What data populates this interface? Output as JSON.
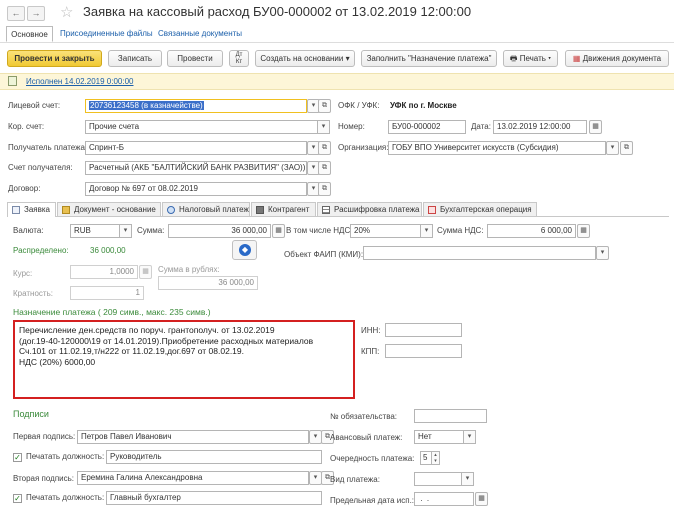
{
  "window": {
    "title": "Заявка на кассовый расход БУ00-000002 от 13.02.2019 12:00:00"
  },
  "nav_tabs": {
    "main": "Основное",
    "attached": "Присоединенные файлы",
    "related": "Связанные документы"
  },
  "toolbar": {
    "post_close": "Провести и закрыть",
    "save": "Записать",
    "post": "Провести",
    "create_based": "Создать на основании",
    "fill_purpose": "Заполнить \"Назначение платежа\"",
    "print": "Печать",
    "movements": "Движения документа"
  },
  "status": {
    "text": "Исполнен 14.02.2019 0:00:00"
  },
  "header_left": {
    "account_label": "Лицевой счет:",
    "account_value": "20736123458 (в казначействе)",
    "corr_label": "Кор. счет:",
    "corr_value": "Прочие счета",
    "recipient_label": "Получатель платежа:",
    "recipient_value": "Спринт-Б",
    "recipient_acc_label": "Счет получателя:",
    "recipient_acc_value": "Расчетный (АКБ \"БАЛТИЙСКИЙ БАНК РАЗВИТИЯ\" (ЗАО))",
    "contract_label": "Договор:",
    "contract_value": "Договор № 697 от 08.02.2019"
  },
  "header_right": {
    "ofk_label": "ОФК / УФК:",
    "ofk_value": "УФК по г. Москве",
    "number_label": "Номер:",
    "number_value": "БУ00-000002",
    "date_label": "Дата:",
    "date_value": "13.02.2019 12:00:00",
    "org_label": "Организация:",
    "org_value": "ГОБУ ВПО Университет искусств (Субсидия)"
  },
  "tabs": [
    {
      "label": "Заявка",
      "icon": "document-icon",
      "active": true
    },
    {
      "label": "Документ - основание",
      "icon": "folder-icon",
      "active": false
    },
    {
      "label": "Налоговый платеж",
      "icon": "tax-icon",
      "active": false
    },
    {
      "label": "Контрагент",
      "icon": "building-icon",
      "active": false
    },
    {
      "label": "Расшифровка платежа",
      "icon": "table-icon",
      "active": false
    },
    {
      "label": "Бухгалтерская операция",
      "icon": "ledger-icon",
      "active": false
    }
  ],
  "request": {
    "currency_label": "Валюта:",
    "currency_value": "RUB",
    "sum_label": "Сумма:",
    "sum_value": "36 000,00",
    "vat_incl_label": "В том числе НДС:",
    "vat_incl_value": "20%",
    "vat_sum_label": "Сумма НДС:",
    "vat_sum_value": "6 000,00",
    "distributed_label": "Распределено:",
    "distributed_value": "36 000,00",
    "rate_label": "Курс:",
    "rate_value": "1,0000",
    "rub_sum_label": "Сумма в рублях:",
    "rub_sum_value": "36 000,00",
    "multiplicity_label": "Кратность:",
    "multiplicity_value": "1",
    "faip_label": "Объект ФАИП (КМИ):",
    "faip_value": ""
  },
  "purpose": {
    "title": "Назначение платежа ( 209 симв., макс. 235 симв.)",
    "lines": [
      "Перечисление ден.средств по поруч. грантополуч. от 13.02.2019",
      "(дог.19-40-120000\\19 от 14.01.2019).Приобретение расходных материалов",
      "Сч.101 от 11.02.19,т/н222 от 11.02.19,дог.697 от 08.02.19.",
      "НДС (20%) 6000,00"
    ],
    "inn_label": "ИНН:",
    "inn_value": "",
    "kpp_label": "КПП:",
    "kpp_value": ""
  },
  "signatures": {
    "title": "Подписи",
    "first_label": "Первая подпись:",
    "first_value": "Петров Павел Иванович",
    "print_pos_label": "Печатать должность:",
    "first_pos_value": "Руководитель",
    "second_label": "Вторая подпись:",
    "second_value": "Еремина Галина Александровна",
    "second_pos_value": "Главный бухгалтер"
  },
  "payment_meta": {
    "obligation_label": "№ обязательства:",
    "obligation_value": "",
    "advance_label": "Авансовый платеж:",
    "advance_value": "Нет",
    "order_label": "Очередность платежа:",
    "order_value": "5",
    "type_label": "Вид платежа:",
    "type_value": "",
    "deadline_label": "Предельная дата исп.:",
    "deadline_value": " .  .  "
  },
  "colors": {
    "primary_button": "#f5d03c",
    "status_bar": "#fdf6d8",
    "link": "#1b5faa",
    "section_green": "#3a8a3a",
    "highlight_border": "#d42020",
    "focus_border": "#f0c020"
  }
}
